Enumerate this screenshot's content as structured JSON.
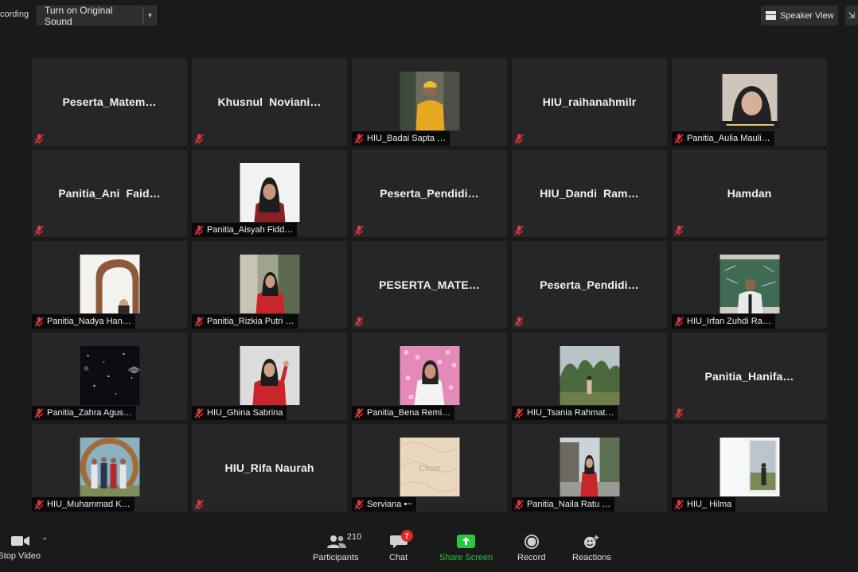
{
  "top_bar": {
    "recording_label": "cording",
    "original_sound_button": "Turn on Original Sound",
    "speaker_view_button": "Speaker View"
  },
  "tiles": [
    {
      "name": "Peserta_Matem…",
      "label_style": "center",
      "thumb": null
    },
    {
      "name": "Khusnul  Noviani…",
      "label_style": "center",
      "thumb": null
    },
    {
      "name": "HIU_Badai Sapta …",
      "label_style": "bottom",
      "thumb": "yellow-hoodie"
    },
    {
      "name": "HIU_raihanahmilr",
      "label_style": "center",
      "thumb": null
    },
    {
      "name": "Panitia_Aulia Mauli…",
      "label_style": "bottom",
      "thumb": "selfie-framed"
    },
    {
      "name": "Panitia_Ani  Faid…",
      "label_style": "center",
      "thumb": null
    },
    {
      "name": "Panitia_Aisyah Fidd…",
      "label_style": "bottom",
      "thumb": "hijab-white-bg"
    },
    {
      "name": "Peserta_Pendidi…",
      "label_style": "center",
      "thumb": null
    },
    {
      "name": "HIU_Dandi  Ram…",
      "label_style": "center",
      "thumb": null
    },
    {
      "name": "Hamdan",
      "label_style": "center",
      "thumb": null
    },
    {
      "name": "Panitia_Nadya Han…",
      "label_style": "bottom",
      "thumb": "mirror-arch"
    },
    {
      "name": "Panitia_Rizkia Putri …",
      "label_style": "bottom",
      "thumb": "red-jacket-outdoor"
    },
    {
      "name": "PESERTA_MATE…",
      "label_style": "center",
      "thumb": null
    },
    {
      "name": "Peserta_Pendidi…",
      "label_style": "center",
      "thumb": null
    },
    {
      "name": "HIU_Irfan Zuhdi Ra…",
      "label_style": "bottom",
      "thumb": "chalkboard"
    },
    {
      "name": "Panitia_Zahra Agus…",
      "label_style": "bottom",
      "thumb": "space"
    },
    {
      "name": "HIU_Ghina Sabrina",
      "label_style": "bottom",
      "thumb": "red-jacket-wave"
    },
    {
      "name": "Panitia_Bena Remi…",
      "label_style": "bottom",
      "thumb": "pink-wall"
    },
    {
      "name": "HIU_Tsania Rahmat…",
      "label_style": "bottom",
      "thumb": "forest"
    },
    {
      "name": "Panitia_Hanifa…",
      "label_style": "center",
      "thumb": null
    },
    {
      "name": "HIU_Muhammad K…",
      "label_style": "bottom",
      "thumb": "group-ring"
    },
    {
      "name": "HIU_Rifa Naurah",
      "label_style": "center",
      "thumb": null
    },
    {
      "name": "Serviana •~",
      "label_style": "bottom",
      "thumb": "beige-pattern"
    },
    {
      "name": "Panitia_Naila Ratu …",
      "label_style": "bottom",
      "thumb": "street-red"
    },
    {
      "name": "HIU_ Hilma",
      "label_style": "bottom",
      "thumb": "white-photo"
    }
  ],
  "toolbar": {
    "stop_video": "Stop Video",
    "participants": "Participants",
    "participants_count": "210",
    "chat": "Chat",
    "chat_badge": "7",
    "share_screen": "Share Screen",
    "record": "Record",
    "reactions": "Reactions"
  },
  "colors": {
    "background": "#1a1a1a",
    "tile": "#262626",
    "share_green": "#28c740",
    "badge_red": "#e02828",
    "mute_red": "#e03a3a"
  }
}
